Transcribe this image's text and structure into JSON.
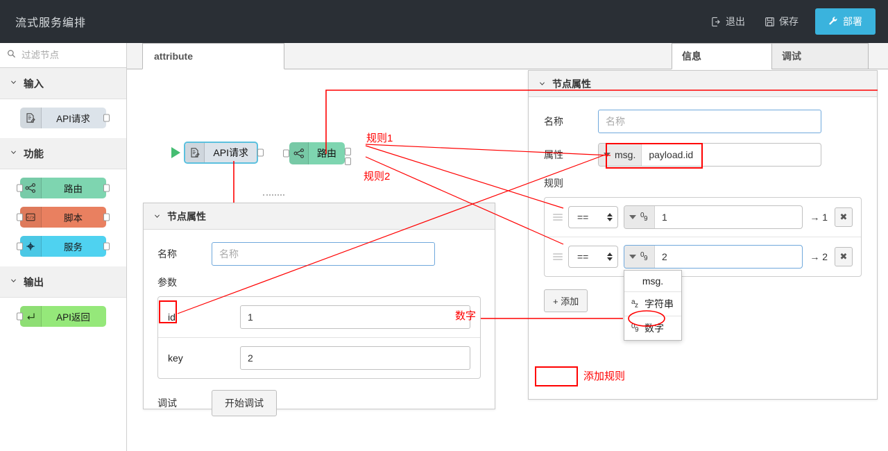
{
  "header": {
    "title": "流式服务编排",
    "exit_label": "退出",
    "save_label": "保存",
    "deploy_label": "部署",
    "deploy_color": "#3ab3dd"
  },
  "sidebar": {
    "filter_placeholder": "过滤节点",
    "categories": [
      {
        "label": "输入",
        "nodes": [
          {
            "label": "API请求",
            "color": "#dce3ea",
            "icon": "document-edit-icon",
            "has_left_port": false,
            "has_right_port": true
          }
        ]
      },
      {
        "label": "功能",
        "nodes": [
          {
            "label": "路由",
            "color": "#7ed5b0",
            "icon": "share-nodes-icon",
            "has_left_port": true,
            "has_right_port": true
          },
          {
            "label": "脚本",
            "color": "#e98060",
            "icon": "code-icon",
            "has_left_port": true,
            "has_right_port": true
          },
          {
            "label": "服务",
            "color": "#4fd2f0",
            "icon": "plus-node-icon",
            "has_left_port": true,
            "has_right_port": true
          }
        ]
      },
      {
        "label": "输出",
        "nodes": [
          {
            "label": "API返回",
            "color": "#95e87a",
            "icon": "return-arrow-icon",
            "has_left_port": true,
            "has_right_port": false
          }
        ]
      }
    ]
  },
  "workspace": {
    "tab_label": "attribute",
    "flow_nodes": [
      {
        "label": "API请求",
        "color": "#dce3ea",
        "icon": "document-edit-icon",
        "selected": true
      },
      {
        "label": "路由",
        "color": "#7ed5b0",
        "icon": "share-nodes-icon",
        "selected": false
      }
    ]
  },
  "left_panel": {
    "title": "节点属性",
    "name_label": "名称",
    "name_value": "",
    "name_placeholder": "名称",
    "params_label": "参数",
    "params": [
      {
        "key": "id",
        "value": "1"
      },
      {
        "key": "key",
        "value": "2"
      }
    ],
    "debug_label": "调试",
    "debug_button": "开始调试"
  },
  "right_panel": {
    "tabs": [
      {
        "label": "信息",
        "active": true
      },
      {
        "label": "调试",
        "active": false
      }
    ],
    "title": "节点属性",
    "name_label": "名称",
    "name_value": "",
    "name_placeholder": "名称",
    "property_label": "属性",
    "property_prefix": "msg.",
    "property_value": "payload.id",
    "rules_label": "规则",
    "rules": [
      {
        "operator": "==",
        "type_icon": "number-type-icon",
        "value": "1",
        "output": "→ 1",
        "delete_label": "✖",
        "focused": false
      },
      {
        "operator": "==",
        "type_icon": "number-type-icon",
        "value": "2",
        "output": "→ 2",
        "delete_label": "✖",
        "focused": true
      }
    ],
    "add_button": "+ 添加",
    "type_dropdown": {
      "visible": true,
      "items": [
        {
          "label": "msg.",
          "icon": "",
          "highlighted": false
        },
        {
          "label": "字符串",
          "icon": "string-type-icon",
          "highlighted": false
        },
        {
          "label": "数字",
          "icon": "number-type-icon",
          "highlighted": true
        }
      ]
    }
  },
  "annotations": {
    "color": "#ff0000",
    "labels": [
      {
        "id": "rule1",
        "text": "规则1"
      },
      {
        "id": "rule2",
        "text": "规则2"
      },
      {
        "id": "number",
        "text": "数字"
      },
      {
        "id": "add_rule",
        "text": "添加规则"
      }
    ]
  }
}
